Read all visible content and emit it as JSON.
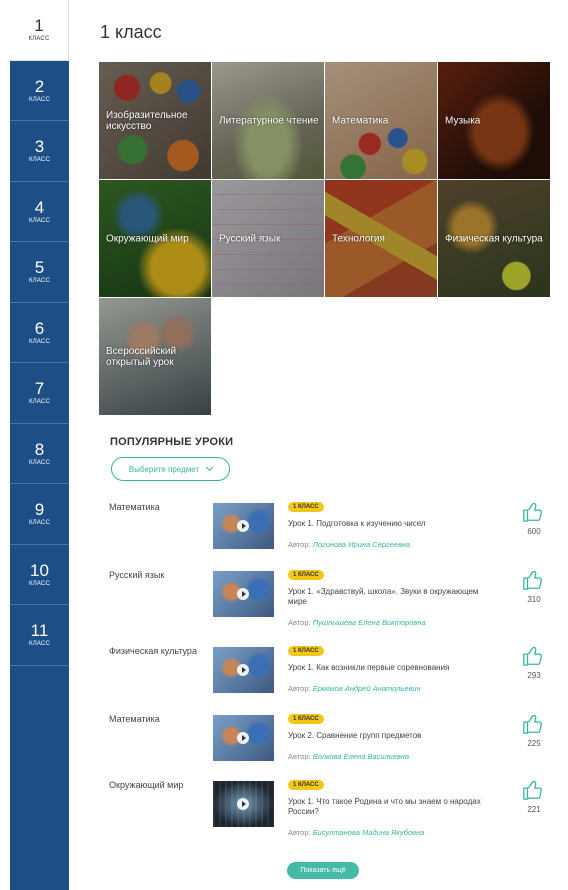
{
  "sidebar": {
    "grades": [
      {
        "num": "1",
        "label": "КЛАСС",
        "active": true
      },
      {
        "num": "2",
        "label": "КЛАСС"
      },
      {
        "num": "3",
        "label": "КЛАСС"
      },
      {
        "num": "4",
        "label": "КЛАСС"
      },
      {
        "num": "5",
        "label": "КЛАСС"
      },
      {
        "num": "6",
        "label": "КЛАСС"
      },
      {
        "num": "7",
        "label": "КЛАСС"
      },
      {
        "num": "8",
        "label": "КЛАСС"
      },
      {
        "num": "9",
        "label": "КЛАСС"
      },
      {
        "num": "10",
        "label": "КЛАСС"
      },
      {
        "num": "11",
        "label": "КЛАСС"
      }
    ]
  },
  "page": {
    "title": "1 класс"
  },
  "subjects": [
    {
      "label": "Изобразительное искусство"
    },
    {
      "label": "Литературное чтение"
    },
    {
      "label": "Математика"
    },
    {
      "label": "Музыка"
    },
    {
      "label": "Окружающий мир"
    },
    {
      "label": "Русский язык"
    },
    {
      "label": "Технология"
    },
    {
      "label": "Физическая культура"
    },
    {
      "label": "Всероссийский открытый урок"
    }
  ],
  "popular": {
    "title": "ПОПУЛЯРНЫЕ УРОКИ",
    "select_label": "Выберите предмет",
    "more_label": "Показать ещё",
    "lessons": [
      {
        "subject": "Математика",
        "badge": "1 КЛАСС",
        "title": "Урок 1. Подготовка к изучению чисел",
        "author_prefix": "Автор:",
        "author": "Логинова Ирина Сергеевна",
        "likes": "600"
      },
      {
        "subject": "Русский язык",
        "badge": "1 КЛАСС",
        "title": "Урок 1. «Здравствуй, школа». Звуки в окружающем мире",
        "author_prefix": "Автор:",
        "author": "Пушпышева Елена Викторовна",
        "likes": "310"
      },
      {
        "subject": "Физическая культура",
        "badge": "1 КЛАСС",
        "title": "Урок 1. Как возникли первые соревнования",
        "author_prefix": "Автор:",
        "author": "Ермаков Андрей Анатольевич",
        "likes": "293"
      },
      {
        "subject": "Математика",
        "badge": "1 КЛАСС",
        "title": "Урок 2. Сравнение групп предметов",
        "author_prefix": "Автор:",
        "author": "Волкова Елена Васильевна",
        "likes": "225"
      },
      {
        "subject": "Окружающий мир",
        "badge": "1 КЛАСС",
        "title": "Урок 1. Что такое Родина и что мы знаем о народах России?",
        "author_prefix": "Автор:",
        "author": "Бисултанова Мадина Якубовна",
        "likes": "221"
      }
    ]
  },
  "colors": {
    "sidebar": "#1d4f86",
    "accent": "#35b59e",
    "badge": "#f2c71a"
  }
}
